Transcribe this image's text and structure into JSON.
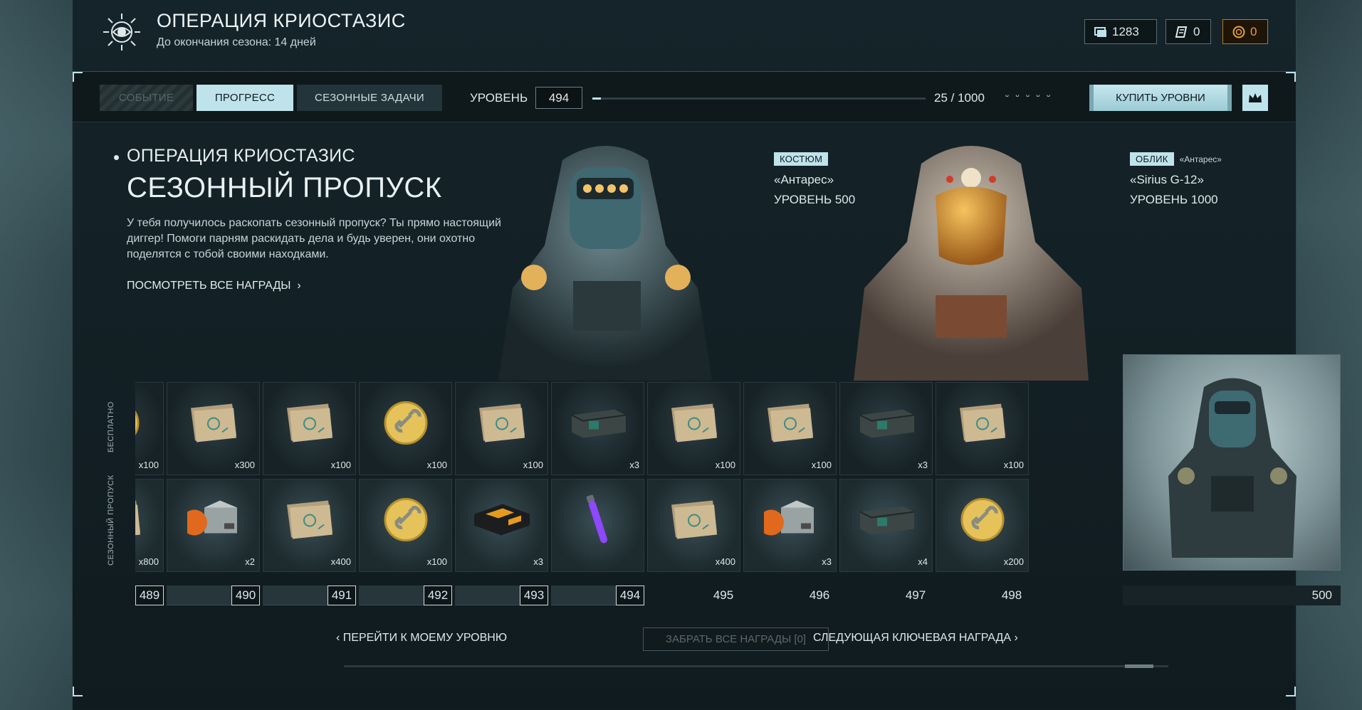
{
  "header": {
    "title": "ОПЕРАЦИЯ КРИОСТАЗИС",
    "subtitle": "До окончания сезона: 14 дней",
    "currencies": [
      {
        "icon": "tickets-icon",
        "value": "1283"
      },
      {
        "icon": "scroll-icon",
        "value": "0"
      },
      {
        "icon": "gold-coin-icon",
        "value": "0",
        "color": "#e6a23a"
      }
    ]
  },
  "tabs": [
    {
      "label": "СОБЫТИЕ",
      "state": "disabled"
    },
    {
      "label": "ПРОГРЕСС",
      "state": "active"
    },
    {
      "label": "СЕЗОННЫЕ ЗАДАЧИ",
      "state": "normal"
    }
  ],
  "level": {
    "label": "УРОВЕНЬ",
    "value": "494",
    "progress_text": "25 / 1000",
    "progress_fraction": 0.025,
    "stars_icon": "ᵕ ᵕ ᵕ ᵕ ᵕ"
  },
  "buy_button": "КУПИТЬ УРОВНИ",
  "info": {
    "kicker": "ОПЕРАЦИЯ КРИОСТАЗИС",
    "title": "СЕЗОННЫЙ ПРОПУСК",
    "description": "У тебя получилось раскопать сезонный пропуск? Ты прямо настоящий диггер! Помоги парням раскидать дела и будь уверен, они охотно поделятся с тобой своими находками.",
    "link": "ПОСМОТРЕТЬ ВСЕ НАГРАДЫ"
  },
  "characters": [
    {
      "badge": "КОСТЮМ",
      "extra": "",
      "name": "«Антарес»",
      "level": "УРОВЕНЬ 500"
    },
    {
      "badge": "ОБЛИК",
      "extra": "«Антарес»",
      "name": "«Sirius G-12»",
      "level": "УРОВЕНЬ 1000"
    }
  ],
  "row_labels": {
    "free": "БЕСПЛАТНО",
    "premium": "СЕЗОННЫЙ ПРОПУСК"
  },
  "columns": [
    {
      "level": "489",
      "free": {
        "item": "coin",
        "qty": "x100"
      },
      "premium": {
        "item": "papers",
        "qty": "x800"
      },
      "unlocked": true
    },
    {
      "level": "490",
      "free": {
        "item": "papers",
        "qty": "x300"
      },
      "premium": {
        "item": "box-orange",
        "qty": "x2"
      },
      "unlocked": true
    },
    {
      "level": "491",
      "free": {
        "item": "papers",
        "qty": "x100"
      },
      "premium": {
        "item": "papers",
        "qty": "x400"
      },
      "unlocked": true
    },
    {
      "level": "492",
      "free": {
        "item": "coin",
        "qty": "x100"
      },
      "premium": {
        "item": "coin",
        "qty": "x100"
      },
      "unlocked": true
    },
    {
      "level": "493",
      "free": {
        "item": "papers",
        "qty": "x100"
      },
      "premium": {
        "item": "case-black",
        "qty": "x3"
      },
      "unlocked": true
    },
    {
      "level": "494",
      "free": {
        "item": "crate",
        "qty": "x3"
      },
      "premium": {
        "item": "glowstick",
        "qty": ""
      },
      "unlocked": true
    },
    {
      "level": "495",
      "free": {
        "item": "papers",
        "qty": "x100"
      },
      "premium": {
        "item": "papers",
        "qty": "x400"
      },
      "unlocked": false
    },
    {
      "level": "496",
      "free": {
        "item": "papers",
        "qty": "x100"
      },
      "premium": {
        "item": "box-orange",
        "qty": "x3"
      },
      "unlocked": false
    },
    {
      "level": "497",
      "free": {
        "item": "crate",
        "qty": "x3"
      },
      "premium": {
        "item": "crate",
        "qty": "x4"
      },
      "unlocked": false
    },
    {
      "level": "498",
      "free": {
        "item": "papers",
        "qty": "x100"
      },
      "premium": {
        "item": "coin",
        "qty": "x200"
      },
      "unlocked": false
    }
  ],
  "big_reward": {
    "level": "500"
  },
  "bottom": {
    "goto_level": "ПЕРЕЙТИ К МОЕМУ УРОВНЮ",
    "claim_all": "ЗАБРАТЬ ВСЕ НАГРАДЫ [0]",
    "next_key": "СЛЕДУЮЩАЯ КЛЮЧЕВАЯ НАГРАДА"
  },
  "colors": {
    "accent": "#bfe3ea",
    "gold": "#e6a23a",
    "dark": "#0f191c"
  }
}
